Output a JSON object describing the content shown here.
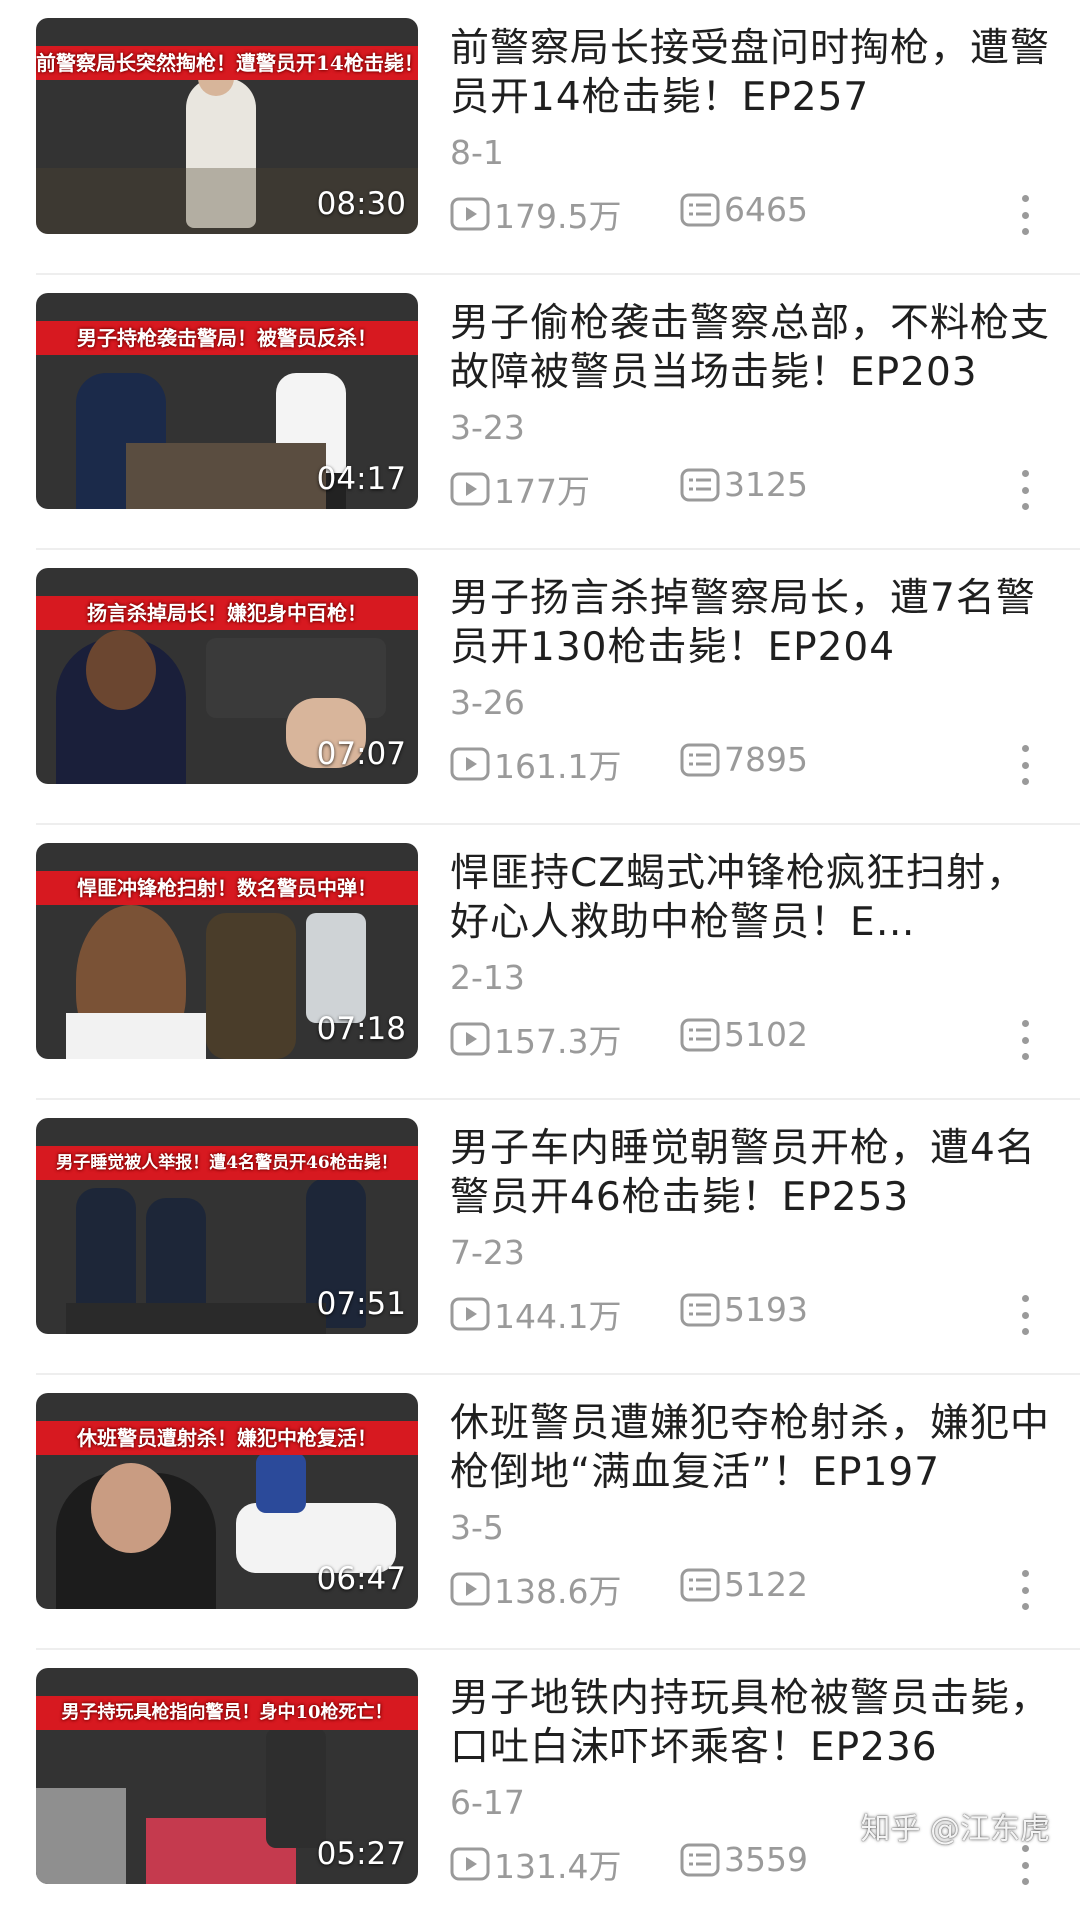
{
  "items": [
    {
      "title": "前警察局长接受盘问时掏枪，遭警员开14枪击毙！EP257",
      "date": "8-1",
      "views": "179.5万",
      "comments": "6465",
      "duration": "08:30",
      "banner": "前警察局长突然掏枪！遭警员开14枪击毙！"
    },
    {
      "title": "男子偷枪袭击警察总部，不料枪支故障被警员当场击毙！EP203",
      "date": "3-23",
      "views": "177万",
      "comments": "3125",
      "duration": "04:17",
      "banner": "男子持枪袭击警局！被警员反杀！"
    },
    {
      "title": "男子扬言杀掉警察局长，遭7名警员开130枪击毙！EP204",
      "date": "3-26",
      "views": "161.1万",
      "comments": "7895",
      "duration": "07:07",
      "banner": "扬言杀掉局长！嫌犯身中百枪！"
    },
    {
      "title": "悍匪持CZ蝎式冲锋枪疯狂扫射，好心人救助中枪警员！E…",
      "date": "2-13",
      "views": "157.3万",
      "comments": "5102",
      "duration": "07:18",
      "banner": "悍匪冲锋枪扫射！数名警员中弹！"
    },
    {
      "title": "男子车内睡觉朝警员开枪，遭4名警员开46枪击毙！EP253",
      "date": "7-23",
      "views": "144.1万",
      "comments": "5193",
      "duration": "07:51",
      "banner": "男子睡觉被人举报！遭4名警员开46枪击毙！"
    },
    {
      "title": "休班警员遭嫌犯夺枪射杀，嫌犯中枪倒地“满血复活”！EP197",
      "date": "3-5",
      "views": "138.6万",
      "comments": "5122",
      "duration": "06:47",
      "banner": "休班警员遭射杀！嫌犯中枪复活！"
    },
    {
      "title": "男子地铁内持玩具枪被警员击毙，口吐白沫吓坏乘客！EP236",
      "date": "6-17",
      "views": "131.4万",
      "comments": "3559",
      "duration": "05:27",
      "banner": "男子持玩具枪指向警员！身中10枪死亡！"
    }
  ],
  "watermark": "知乎 @江东虎",
  "colors": {
    "banner_bg": "#d71920",
    "meta": "#9a9a9a",
    "title": "#1f1f1f"
  }
}
